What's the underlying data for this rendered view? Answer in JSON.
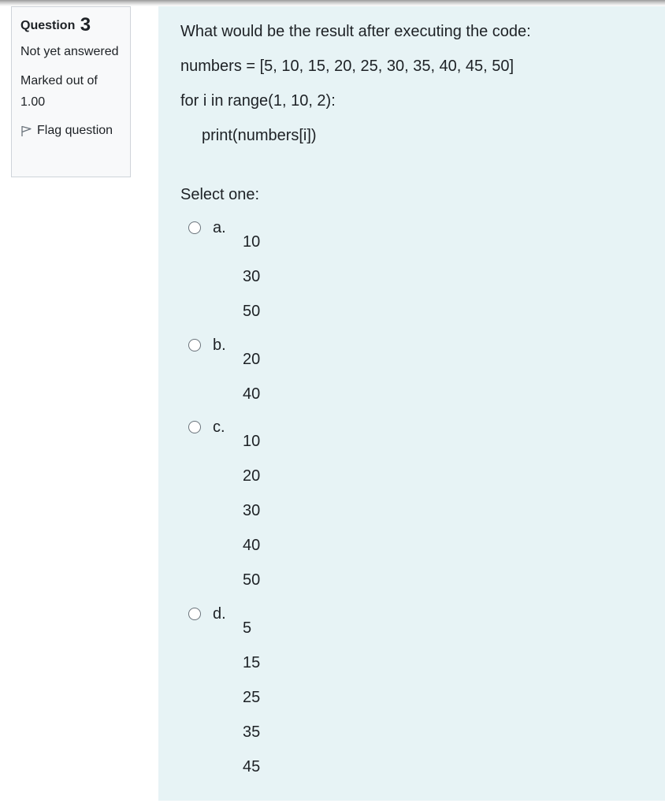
{
  "question_info": {
    "label": "Question",
    "number": "3",
    "state": "Not yet answered",
    "grade": "Marked out of 1.00",
    "flag_label": "Flag question"
  },
  "question": {
    "lines": [
      "What would be the result after executing the code:",
      "numbers = [5, 10, 15, 20, 25, 30, 35, 40, 45, 50]",
      "for i in range(1, 10, 2):",
      "print(numbers[i])"
    ],
    "prompt": "Select one:"
  },
  "options": [
    {
      "label": "a.",
      "values": [
        "10",
        "30",
        "50"
      ]
    },
    {
      "label": "b.",
      "values": [
        "20",
        "40"
      ]
    },
    {
      "label": "c.",
      "values": [
        "10",
        "20",
        "30",
        "40",
        "50"
      ]
    },
    {
      "label": "d.",
      "values": [
        "5",
        "15",
        "25",
        "35",
        "45"
      ]
    }
  ],
  "colors": {
    "content_bg": "#e7f3f5",
    "info_bg": "#f8f9fa",
    "text": "#1d2125"
  }
}
